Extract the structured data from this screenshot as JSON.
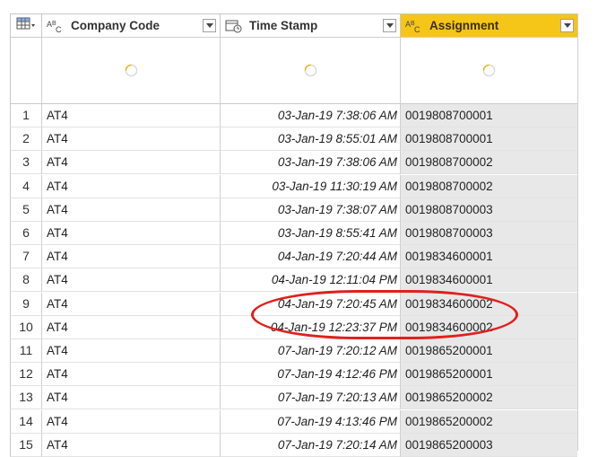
{
  "columns": [
    {
      "type_icon": "ABC-text-icon",
      "label": "Company Code"
    },
    {
      "type_icon": "datetime-icon",
      "label": "Time Stamp"
    },
    {
      "type_icon": "ABC-text-icon",
      "label": "Assignment"
    }
  ],
  "rows": [
    {
      "n": "1",
      "code": "AT4",
      "ts": "03-Jan-19 7:38:06 AM",
      "asg": "0019808700001"
    },
    {
      "n": "2",
      "code": "AT4",
      "ts": "03-Jan-19 8:55:01 AM",
      "asg": "0019808700001"
    },
    {
      "n": "3",
      "code": "AT4",
      "ts": "03-Jan-19 7:38:06 AM",
      "asg": "0019808700002"
    },
    {
      "n": "4",
      "code": "AT4",
      "ts": "03-Jan-19 11:30:19 AM",
      "asg": "0019808700002"
    },
    {
      "n": "5",
      "code": "AT4",
      "ts": "03-Jan-19 7:38:07 AM",
      "asg": "0019808700003"
    },
    {
      "n": "6",
      "code": "AT4",
      "ts": "03-Jan-19 8:55:41 AM",
      "asg": "0019808700003"
    },
    {
      "n": "7",
      "code": "AT4",
      "ts": "04-Jan-19 7:20:44 AM",
      "asg": "0019834600001"
    },
    {
      "n": "8",
      "code": "AT4",
      "ts": "04-Jan-19 12:11:04 PM",
      "asg": "0019834600001"
    },
    {
      "n": "9",
      "code": "AT4",
      "ts": "04-Jan-19 7:20:45 AM",
      "asg": "0019834600002"
    },
    {
      "n": "10",
      "code": "AT4",
      "ts": "04-Jan-19 12:23:37 PM",
      "asg": "0019834600002"
    },
    {
      "n": "11",
      "code": "AT4",
      "ts": "07-Jan-19 7:20:12 AM",
      "asg": "0019865200001"
    },
    {
      "n": "12",
      "code": "AT4",
      "ts": "07-Jan-19 4:12:46 PM",
      "asg": "0019865200001"
    },
    {
      "n": "13",
      "code": "AT4",
      "ts": "07-Jan-19 7:20:13 AM",
      "asg": "0019865200002"
    },
    {
      "n": "14",
      "code": "AT4",
      "ts": "07-Jan-19 4:13:46 PM",
      "asg": "0019865200002"
    },
    {
      "n": "15",
      "code": "AT4",
      "ts": "07-Jan-19 7:20:14 AM",
      "asg": "0019865200003"
    }
  ],
  "highlight_color": "#e0201f",
  "selected_header_color": "#f5c518"
}
